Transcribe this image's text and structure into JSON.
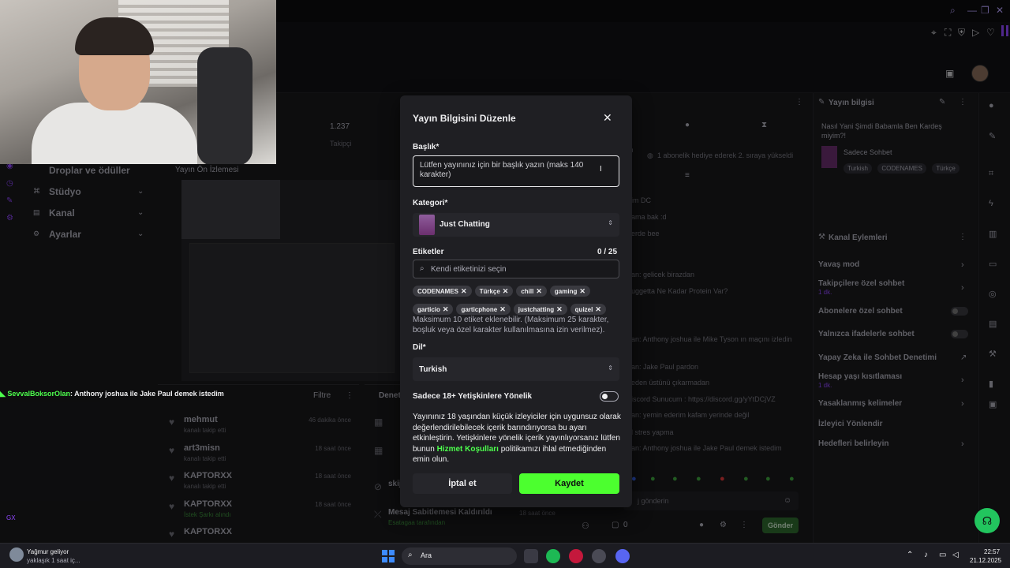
{
  "left_nav": {
    "drops": "Droplar ve ödüller",
    "studio": "Stüdyo",
    "channel": "Kanal",
    "settings": "Ayarlar",
    "preview_title": "Yayın Ön İzlemesi"
  },
  "stats": {
    "followers_count": "1.237",
    "followers_label": "Takipçi"
  },
  "overlay_chat": {
    "user": "SevvalBoksorOlan",
    "text": ": Anthony joshua ile Jake Paul demek istedim"
  },
  "activity_feed": {
    "filter": "Filtre",
    "items": [
      {
        "name": "mehmut",
        "sub": "kanalı takip etti",
        "time": "46 dakika önce"
      },
      {
        "name": "art3misn",
        "sub": "kanalı takip etti",
        "time": "18 saat önce"
      },
      {
        "name": "KAPTORXX",
        "sub": "kanalı takip etti",
        "time": "18 saat önce"
      },
      {
        "name": "KAPTORXX",
        "sub": "İstek Şarkı alındı",
        "time": "18 saat önce"
      },
      {
        "name": "KAPTORXX",
        "sub": "",
        "time": ""
      }
    ],
    "pin_removed": "Mesaj Sabitlemesi Kaldırıldı",
    "pin_removed_by": "Esatagaa tarafından",
    "pin_removed_time": "18 saat önce"
  },
  "chat": {
    "lines": [
      "1 abonelik hediye ederek 2. sıraya yükseldi",
      "im DC",
      "ama bak :d",
      "erde bee",
      "an: gelicek birazdan",
      "uggetta Ne Kadar Protein Var?",
      "an: Anthony joshua ile Mike Tyson ın maçını izledin",
      "an: Jake Paul pardon",
      "eden üstünü çıkarmadan",
      "iscord Sunucum : https://discord.gg/yYtDCjVZ",
      "an: yemin ederim kafam yerinde değil",
      "l stres yapma",
      "an: Anthony joshua ile Jake Paul demek istedim"
    ],
    "input_placeholder": "j gönderin",
    "points": "0",
    "send": "Gönder"
  },
  "stream_info": {
    "title": "Yayın bilgisi",
    "stream_title": "Nasıl Yani Şimdi Babamla Ben Kardeş miyim?!",
    "category": "Sadece Sohbet",
    "tags": [
      "Turkish",
      "CODENAMES",
      "Türkçe"
    ]
  },
  "channel_actions": {
    "title": "Kanal Eylemleri",
    "items": [
      {
        "label": "Yavaş mod",
        "sub": ""
      },
      {
        "label": "Takipçilere özel sohbet",
        "sub": "1 dk."
      },
      {
        "label": "Abonelere özel sohbet",
        "sub": ""
      },
      {
        "label": "Yalnızca ifadelerle sohbet",
        "sub": ""
      },
      {
        "label": "Yapay Zeka ile Sohbet Denetimi",
        "sub": ""
      },
      {
        "label": "Hesap yaşı kısıtlaması",
        "sub": "1 dk."
      },
      {
        "label": "Yasaklanmış kelimeler",
        "sub": ""
      },
      {
        "label": "İzleyici Yönlendir",
        "sub": ""
      },
      {
        "label": "Hedefleri belirleyin",
        "sub": ""
      }
    ]
  },
  "modal": {
    "title": "Yayın Bilgisini Düzenle",
    "title_label": "Başlık*",
    "title_placeholder": "Lütfen yayınınız için bir başlık yazın (maks 140 karakter)",
    "category_label": "Kategori*",
    "category_value": "Just Chatting",
    "tags_label": "Etiketler",
    "tags_count": "0 / 25",
    "tags_placeholder": "Kendi etiketinizi seçin",
    "tags": [
      "CODENAMES",
      "Türkçe",
      "chill",
      "gaming",
      "garticio",
      "garticphone",
      "justchatting",
      "quizel"
    ],
    "tags_help": "Maksimum 10 etiket eklenebilir. (Maksimum 25 karakter, boşluk veya özel karakter kullanılmasına izin verilmez).",
    "language_label": "Dil*",
    "language_value": "Turkish",
    "adult_label": "Sadece 18+ Yetişkinlere Yönelik",
    "adult_enabled": false,
    "warning_part1": "Yayınınız 18 yaşından küçük izleyiciler için uygunsuz olarak değerlendirilebilecek içerik barındırıyorsa bu ayarı etkinleştirin. Yetişkinlere yönelik içerik yayınlıyorsanız lütfen bunun ",
    "warning_link": "Hizmet Koşulları",
    "warning_part2": " politikamızı ihlal etmediğinden emin olun.",
    "cancel": "İptal et",
    "save": "Kaydet"
  },
  "taskbar": {
    "weather_title": "Yağmur geliyor",
    "weather_sub": "yaklaşık 1 saat iç...",
    "search": "Ara",
    "time": "22:57",
    "date": "21.12.2025"
  },
  "colors": {
    "accent_green": "#4cff2f",
    "accent_purple": "#9147ff",
    "modal_bg": "#1f1f23"
  }
}
